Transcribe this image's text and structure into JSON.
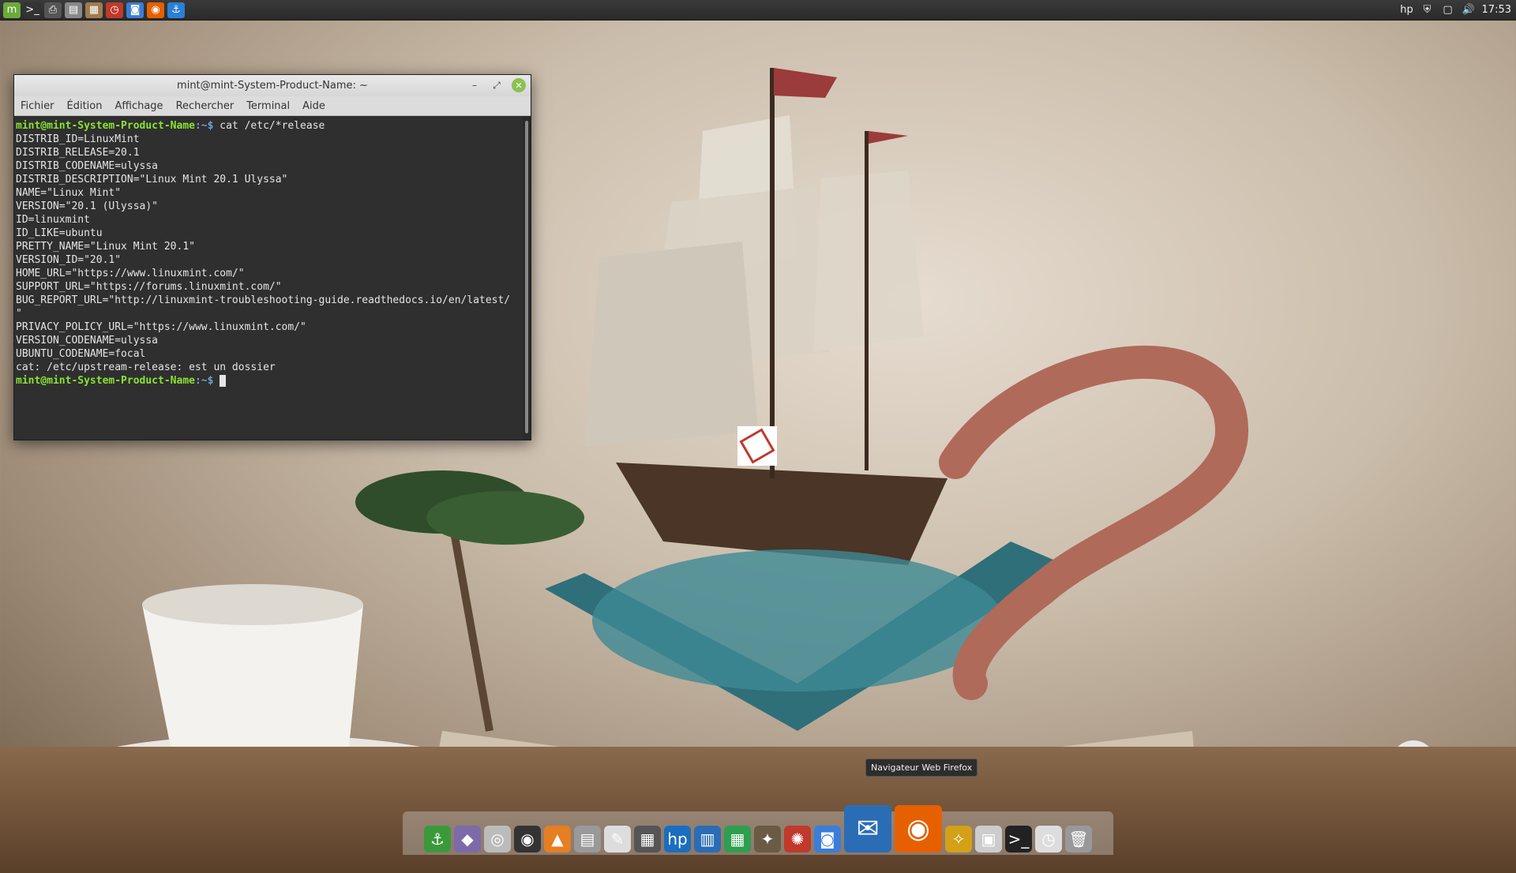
{
  "top_panel": {
    "launchers": [
      {
        "name": "mint-menu-icon",
        "glyph": "m",
        "bg": "#6aaa3a"
      },
      {
        "name": "terminal-icon",
        "glyph": ">_",
        "bg": "#333333"
      },
      {
        "name": "printer-icon",
        "glyph": "⎙",
        "bg": "#555555"
      },
      {
        "name": "files-icon",
        "glyph": "▤",
        "bg": "#888888"
      },
      {
        "name": "archive-icon",
        "glyph": "▦",
        "bg": "#a07b4f"
      },
      {
        "name": "timeshift-icon",
        "glyph": "◷",
        "bg": "#c0392b"
      },
      {
        "name": "screenshot-icon",
        "glyph": "◙",
        "bg": "#3b7dd8"
      },
      {
        "name": "firefox-icon",
        "glyph": "◉",
        "bg": "#e66000"
      },
      {
        "name": "anchor-icon",
        "glyph": "⚓",
        "bg": "#2a7fd8"
      }
    ],
    "tray": [
      {
        "name": "hp-icon",
        "glyph": "hp"
      },
      {
        "name": "shield-icon",
        "glyph": "⛨"
      },
      {
        "name": "notifications-icon",
        "glyph": "▢"
      },
      {
        "name": "volume-icon",
        "glyph": "🔊"
      }
    ],
    "clock": "17:53"
  },
  "terminal": {
    "title": "mint@mint-System-Product-Name: ~",
    "menu": [
      "Fichier",
      "Édition",
      "Affichage",
      "Rechercher",
      "Terminal",
      "Aide"
    ],
    "prompt_user": "mint@mint-System-Product-Name",
    "prompt_path": ":~$ ",
    "command": "cat /etc/*release",
    "output": [
      "DISTRIB_ID=LinuxMint",
      "DISTRIB_RELEASE=20.1",
      "DISTRIB_CODENAME=ulyssa",
      "DISTRIB_DESCRIPTION=\"Linux Mint 20.1 Ulyssa\"",
      "NAME=\"Linux Mint\"",
      "VERSION=\"20.1 (Ulyssa)\"",
      "ID=linuxmint",
      "ID_LIKE=ubuntu",
      "PRETTY_NAME=\"Linux Mint 20.1\"",
      "VERSION_ID=\"20.1\"",
      "HOME_URL=\"https://www.linuxmint.com/\"",
      "SUPPORT_URL=\"https://forums.linuxmint.com/\"",
      "BUG_REPORT_URL=\"http://linuxmint-troubleshooting-guide.readthedocs.io/en/latest/",
      "\"",
      "PRIVACY_POLICY_URL=\"https://www.linuxmint.com/\"",
      "VERSION_CODENAME=ulyssa",
      "UBUNTU_CODENAME=focal",
      "cat: /etc/upstream-release: est un dossier"
    ],
    "final_prompt_path": ":~$ "
  },
  "tooltip": "Navigateur Web Firefox",
  "dock": [
    {
      "name": "dock-anchor-icon",
      "glyph": "⚓",
      "bg": "#3a9a3a",
      "big": false
    },
    {
      "name": "dock-diamond-icon",
      "glyph": "◆",
      "bg": "#7d6aa8",
      "big": false
    },
    {
      "name": "dock-disc-icon",
      "glyph": "◎",
      "bg": "#bbbbbb",
      "big": false
    },
    {
      "name": "dock-speaker-icon",
      "glyph": "◉",
      "bg": "#333333",
      "big": false
    },
    {
      "name": "dock-vlc-icon",
      "glyph": "▲",
      "bg": "#e67e22",
      "big": false
    },
    {
      "name": "dock-files-icon",
      "glyph": "▤",
      "bg": "#999999",
      "big": false
    },
    {
      "name": "dock-text-editor-icon",
      "glyph": "✎",
      "bg": "#dddddd",
      "big": false
    },
    {
      "name": "dock-calculator-icon",
      "glyph": "▦",
      "bg": "#555555",
      "big": false
    },
    {
      "name": "dock-hp-icon",
      "glyph": "hp",
      "bg": "#1a6ec0",
      "big": false
    },
    {
      "name": "dock-writer-icon",
      "glyph": "▥",
      "bg": "#2a6db5",
      "big": false
    },
    {
      "name": "dock-calc-sheet-icon",
      "glyph": "▦",
      "bg": "#2e9e4f",
      "big": false
    },
    {
      "name": "dock-gimp-icon",
      "glyph": "✦",
      "bg": "#6b5b45",
      "big": false
    },
    {
      "name": "dock-color-wheel-icon",
      "glyph": "✺",
      "bg": "#c0392b",
      "big": false
    },
    {
      "name": "dock-screenshot-icon",
      "glyph": "◙",
      "bg": "#3b7dd8",
      "big": false
    },
    {
      "name": "dock-thunderbird-icon",
      "glyph": "✉",
      "bg": "#2a6db5",
      "big": true
    },
    {
      "name": "dock-firefox-icon",
      "glyph": "◉",
      "bg": "#e66000",
      "big": true
    },
    {
      "name": "dock-cleaner-icon",
      "glyph": "✧",
      "bg": "#d4a017",
      "big": false
    },
    {
      "name": "dock-archive-icon",
      "glyph": "▣",
      "bg": "#cccccc",
      "big": false
    },
    {
      "name": "dock-terminal-icon",
      "glyph": ">_",
      "bg": "#222222",
      "big": false
    },
    {
      "name": "dock-clock-icon",
      "glyph": "◷",
      "bg": "#dddddd",
      "big": false
    },
    {
      "name": "dock-trash-icon",
      "glyph": "🗑",
      "bg": "#999999",
      "big": false
    }
  ]
}
